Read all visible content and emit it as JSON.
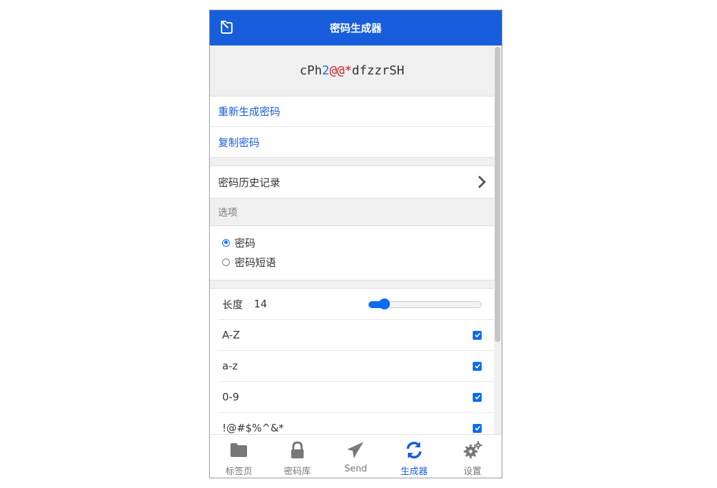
{
  "header": {
    "title": "密码生成器",
    "back_icon": "popout-icon"
  },
  "password": {
    "prefix": "cPh",
    "digit": "2",
    "symbols": "@@*",
    "suffix": "dfzzrSH"
  },
  "actions": {
    "regenerate": "重新生成密码",
    "copy": "复制密码"
  },
  "history": {
    "label": "密码历史记录"
  },
  "options": {
    "section_label": "选项",
    "types": [
      {
        "label": "密码",
        "selected": true
      },
      {
        "label": "密码短语",
        "selected": false
      }
    ],
    "length_label": "长度",
    "length_value": "14",
    "length_fraction": 0.1,
    "checks": [
      {
        "label": "A-Z",
        "checked": true
      },
      {
        "label": "a-z",
        "checked": true
      },
      {
        "label": "0-9",
        "checked": true
      },
      {
        "label": "!@#$%^&*",
        "checked": true
      }
    ]
  },
  "tabs": [
    {
      "label": "标签页",
      "icon": "folder-icon",
      "active": false
    },
    {
      "label": "密码库",
      "icon": "lock-icon",
      "active": false
    },
    {
      "label": "Send",
      "icon": "send-icon",
      "active": false
    },
    {
      "label": "生成器",
      "icon": "refresh-icon",
      "active": true
    },
    {
      "label": "设置",
      "icon": "gears-icon",
      "active": false
    }
  ],
  "colors": {
    "accent": "#175ddc",
    "control": "#0b6cf0",
    "symbol": "#c8222e"
  }
}
